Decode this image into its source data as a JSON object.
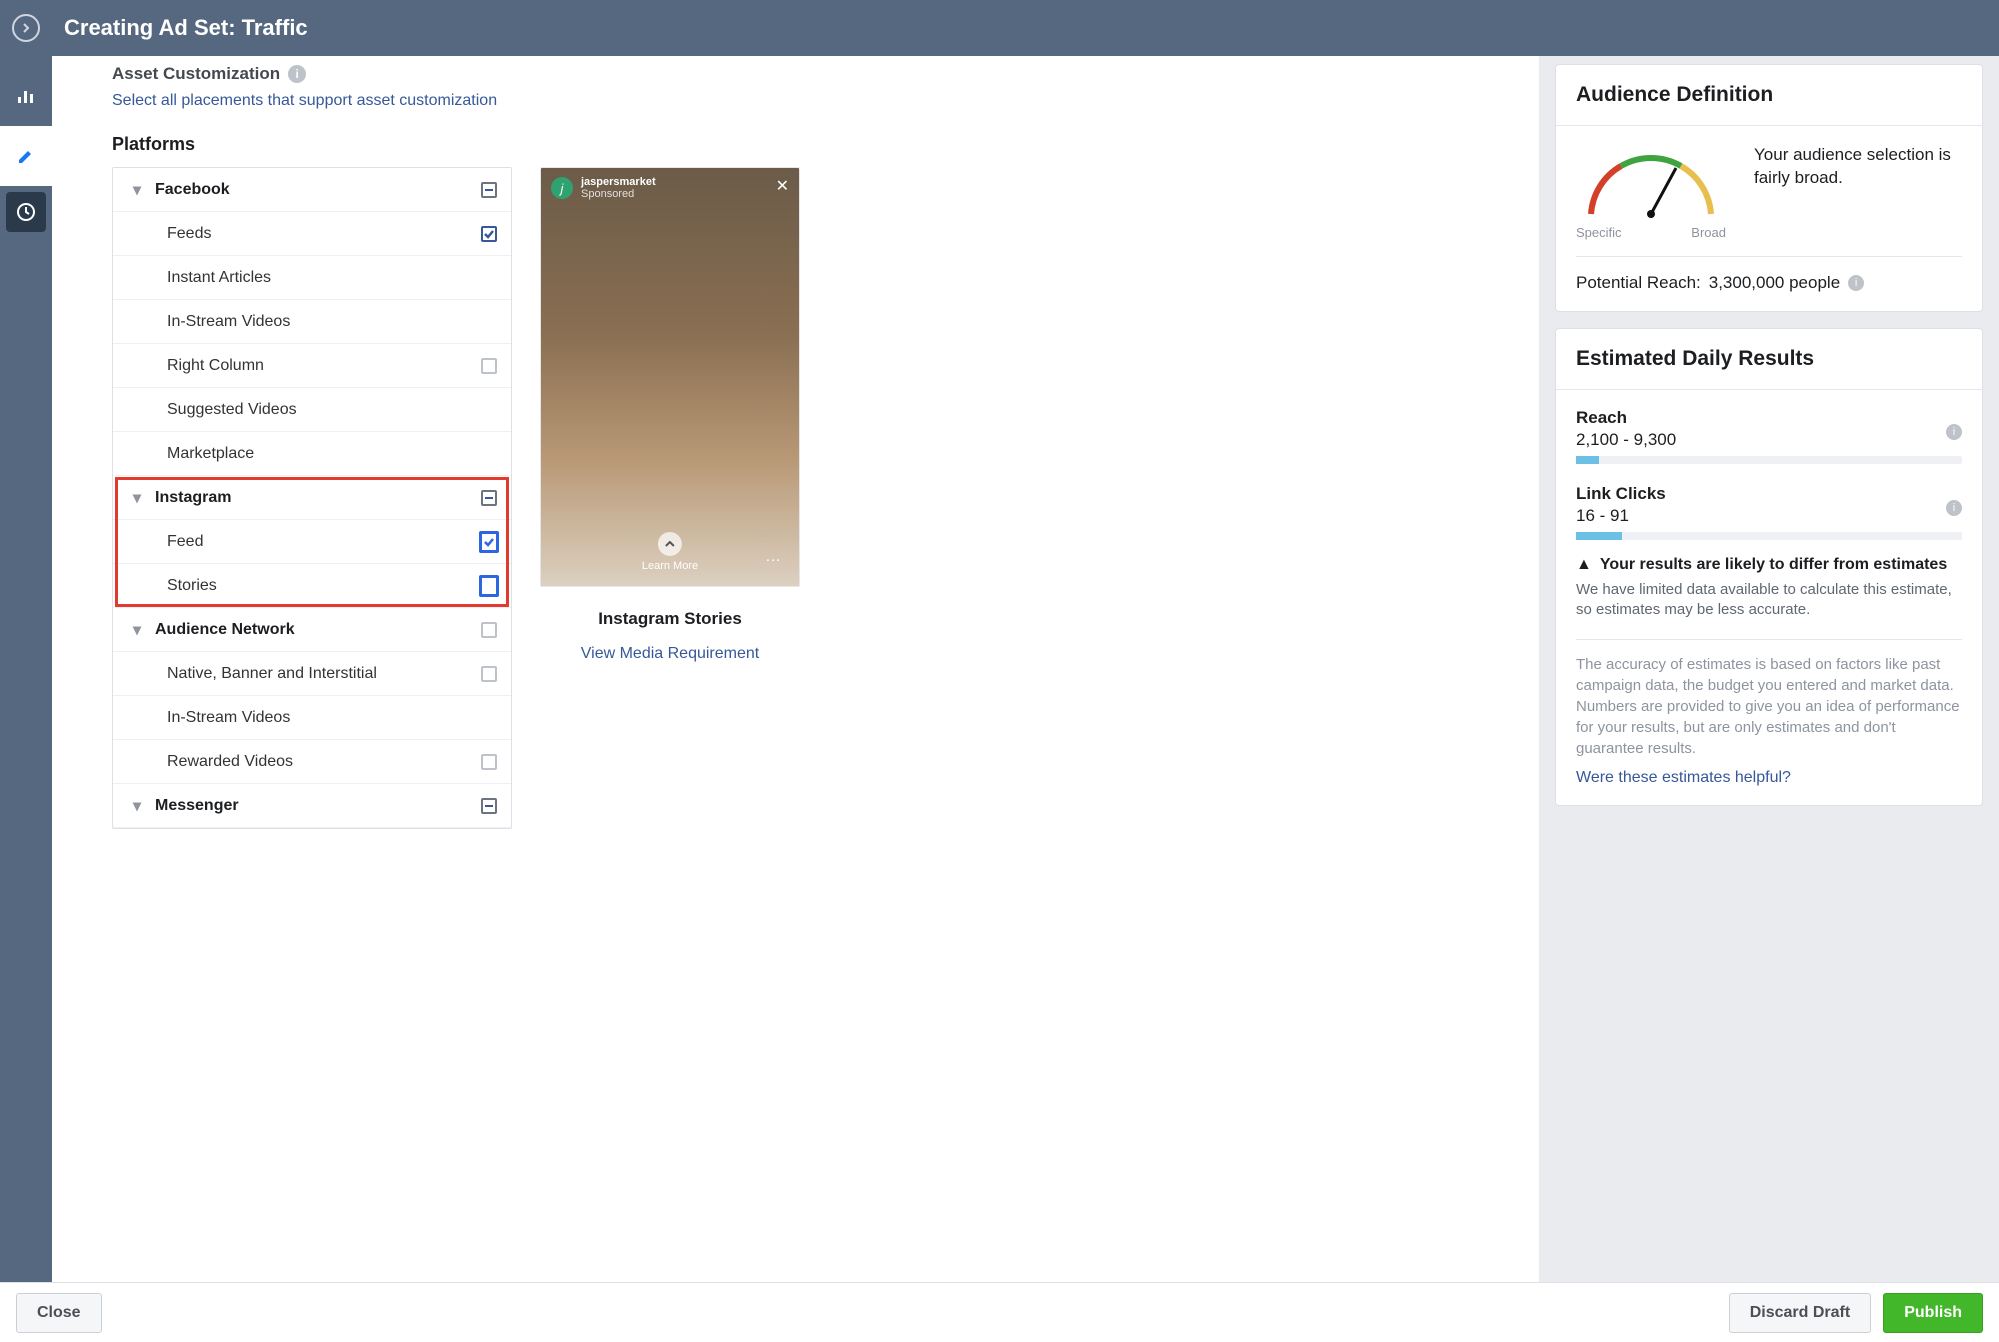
{
  "header": {
    "title": "Creating Ad Set: Traffic"
  },
  "asset": {
    "title": "Asset Customization",
    "link": "Select all placements that support asset customization"
  },
  "platforms_label": "Platforms",
  "platforms": [
    {
      "name": "Facebook",
      "state": "partial",
      "children": [
        {
          "name": "Feeds",
          "state": "checked"
        },
        {
          "name": "Instant Articles",
          "state": "none"
        },
        {
          "name": "In-Stream Videos",
          "state": "none"
        },
        {
          "name": "Right Column",
          "state": "empty"
        },
        {
          "name": "Suggested Videos",
          "state": "none"
        },
        {
          "name": "Marketplace",
          "state": "none"
        }
      ]
    },
    {
      "name": "Instagram",
      "state": "partial",
      "highlight": true,
      "children": [
        {
          "name": "Feed",
          "state": "checked",
          "big": true
        },
        {
          "name": "Stories",
          "state": "empty",
          "big": true
        }
      ]
    },
    {
      "name": "Audience Network",
      "state": "empty",
      "children": [
        {
          "name": "Native, Banner and Interstitial",
          "state": "empty"
        },
        {
          "name": "In-Stream Videos",
          "state": "none"
        },
        {
          "name": "Rewarded Videos",
          "state": "empty"
        }
      ]
    },
    {
      "name": "Messenger",
      "state": "partial",
      "children": []
    }
  ],
  "preview": {
    "brand": "jaspersmarket",
    "sponsored": "Sponsored",
    "learn_more": "Learn More",
    "title": "Instagram Stories",
    "media_link": "View Media Requirement"
  },
  "audience": {
    "title": "Audience Definition",
    "summary": "Your audience selection is fairly broad.",
    "specific": "Specific",
    "broad": "Broad",
    "reach_label": "Potential Reach:",
    "reach_value": "3,300,000 people"
  },
  "results": {
    "title": "Estimated Daily Results",
    "reach_label": "Reach",
    "reach_value": "2,100 - 9,300",
    "clicks_label": "Link Clicks",
    "clicks_value": "16 - 91",
    "warn_title": "Your results are likely to differ from estimates",
    "warn_body": "We have limited data available to calculate this estimate, so estimates may be less accurate.",
    "footnote": "The accuracy of estimates is based on factors like past campaign data, the budget you entered and market data. Numbers are provided to give you an idea of performance for your results, but are only estimates and don't guarantee results.",
    "helpful": "Were these estimates helpful?"
  },
  "footer": {
    "close": "Close",
    "discard": "Discard Draft",
    "publish": "Publish"
  }
}
